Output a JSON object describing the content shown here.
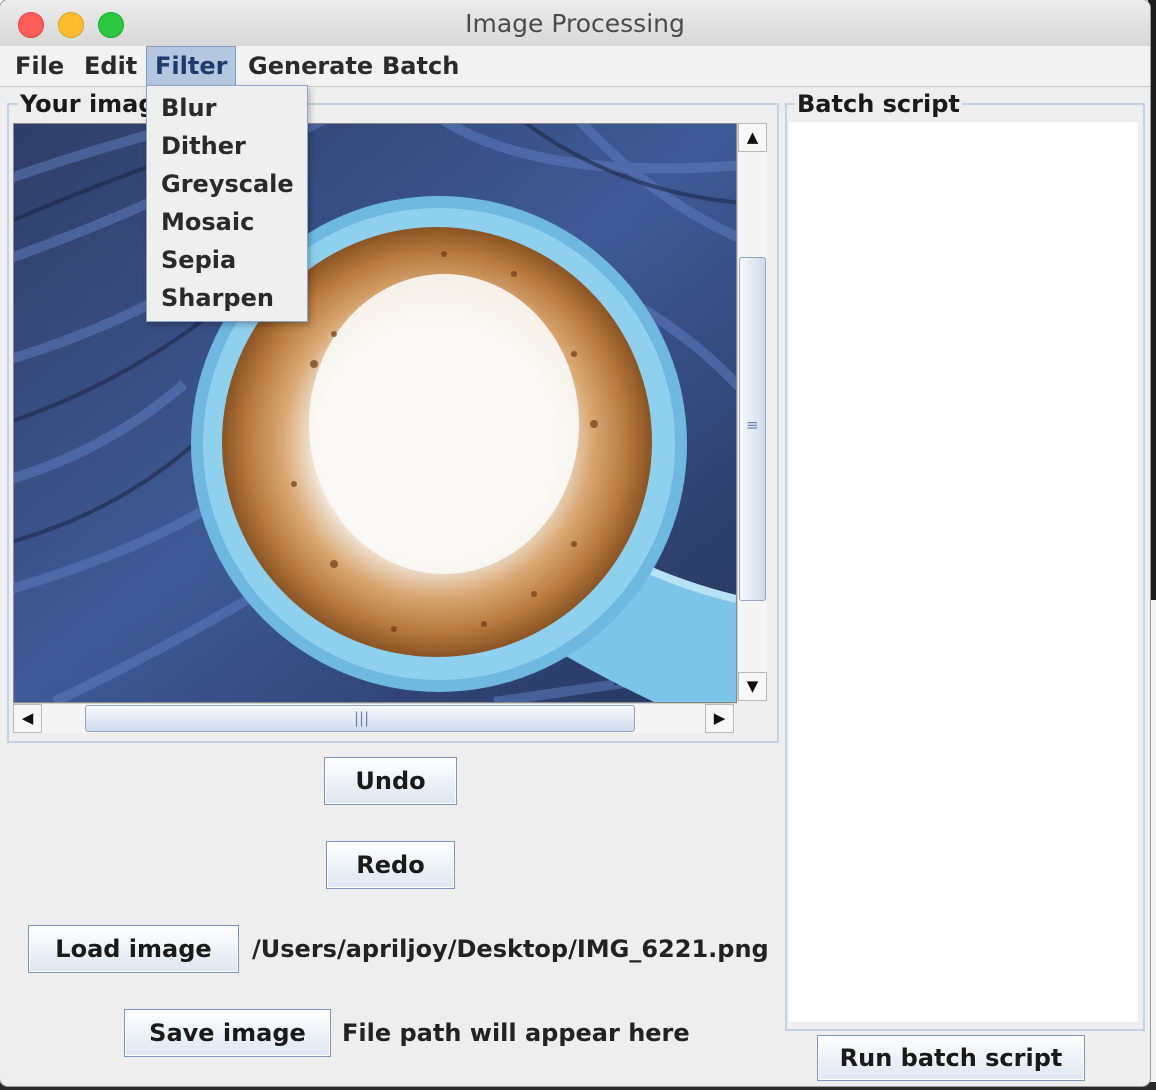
{
  "window": {
    "title": "Image Processing"
  },
  "menu": {
    "file": "File",
    "edit": "Edit",
    "filter": "Filter",
    "generate": "Generate",
    "batch": "Batch"
  },
  "filter_menu": {
    "items": [
      "Blur",
      "Dither",
      "Greyscale",
      "Mosaic",
      "Sepia",
      "Sharpen"
    ]
  },
  "image_panel": {
    "title": "Your image"
  },
  "buttons": {
    "undo": "Undo",
    "redo": "Redo",
    "load": "Load image",
    "save": "Save image",
    "run_batch": "Run batch script"
  },
  "paths": {
    "loaded": "/Users/apriljoy/Desktop/IMG_6221.png",
    "save_placeholder": "File path will appear here"
  },
  "batch_panel": {
    "title": "Batch script",
    "content": ""
  },
  "icons": {
    "close": "close-window-icon",
    "minimize": "minimize-window-icon",
    "maximize": "maximize-window-icon",
    "scroll_up": "scroll-up-arrow-icon",
    "scroll_down": "scroll-down-arrow-icon",
    "scroll_left": "scroll-left-arrow-icon",
    "scroll_right": "scroll-right-arrow-icon"
  },
  "colors": {
    "close": "#fd5f57",
    "minimize": "#febc2e",
    "maximize": "#29c840",
    "menu_active": "#b4c6e0",
    "border_accent": "#c3d2e5"
  }
}
